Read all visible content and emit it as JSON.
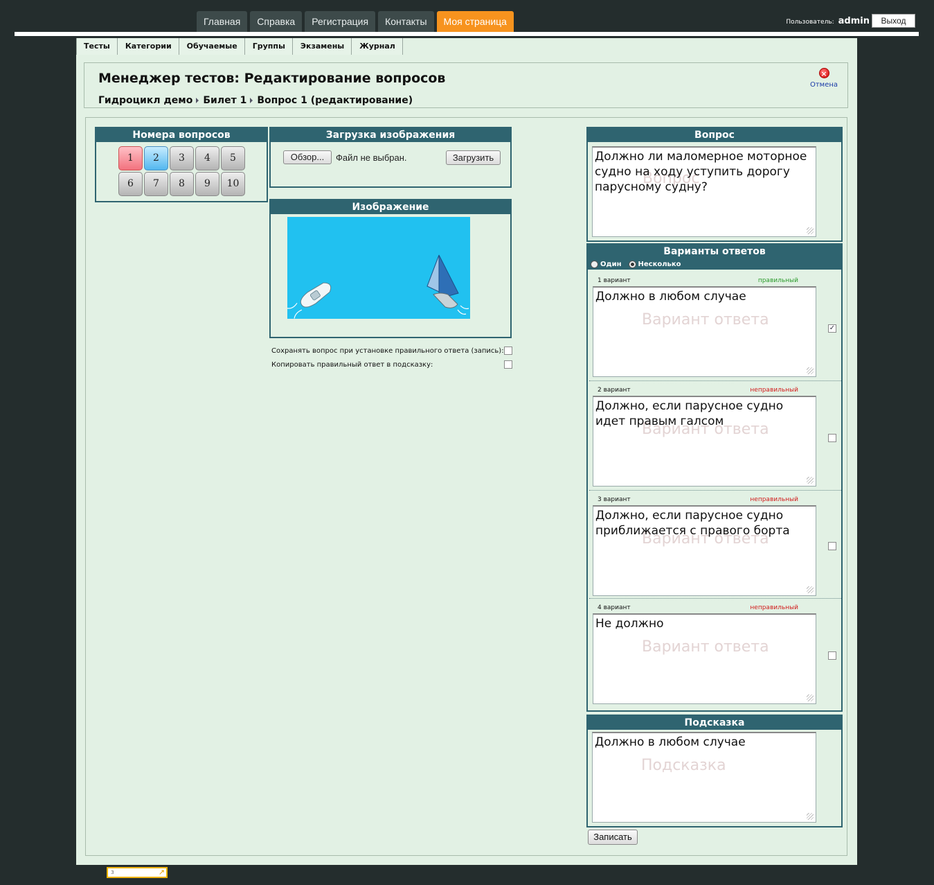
{
  "topnav": {
    "tabs": [
      {
        "label": "Главная",
        "active": false
      },
      {
        "label": "Справка",
        "active": false
      },
      {
        "label": "Регистрация",
        "active": false
      },
      {
        "label": "Контакты",
        "active": false
      },
      {
        "label": "Моя страница",
        "active": true
      }
    ],
    "user_label": "Пользователь:",
    "user_name": "admin",
    "logout_label": "Выход"
  },
  "subnav": {
    "tabs": [
      "Тесты",
      "Категории",
      "Обучаемые",
      "Группы",
      "Экзамены",
      "Журнал"
    ]
  },
  "header": {
    "title": "Менеджер тестов: Редактирование вопросов",
    "breadcrumb": [
      "Гидроцикл демо",
      "Билет 1",
      "Вопрос 1 (редактирование)"
    ],
    "cancel_label": "Отмена",
    "cancel_icon": "close-icon"
  },
  "question_numbers": {
    "title": "Номера вопросов",
    "items": [
      "1",
      "2",
      "3",
      "4",
      "5",
      "6",
      "7",
      "8",
      "9",
      "10"
    ],
    "current": "1",
    "highlighted": "2"
  },
  "upload": {
    "title": "Загрузка изображения",
    "browse_label": "Обзор...",
    "no_file_label": "Файл не выбран.",
    "upload_label": "Загрузить"
  },
  "image": {
    "title": "Изображение",
    "water_color": "#21c1f0"
  },
  "options": {
    "save_on_correct": "Сохранять вопрос при установке правильного ответа (запись):",
    "copy_to_hint": "Копировать правильный ответ в подсказку:"
  },
  "question": {
    "title": "Вопрос",
    "placeholder": "Вопрос",
    "text": "Должно ли маломерное моторное судно на ходу уступить дорогу парусному судну?"
  },
  "answers": {
    "title": "Варианты ответов",
    "mode_one": "Один",
    "mode_many": "Несколько",
    "placeholder": "Вариант ответа",
    "items": [
      {
        "label": "1 вариант",
        "status": "правильный",
        "correct": true,
        "text": "Должно в любом случае"
      },
      {
        "label": "2 вариант",
        "status": "неправильный",
        "correct": false,
        "text": "Должно, если парусное судно идет правым галсом"
      },
      {
        "label": "3 вариант",
        "status": "неправильный",
        "correct": false,
        "text": "Должно, если парусное судно приближается с правого борта"
      },
      {
        "label": "4 вариант",
        "status": "неправильный",
        "correct": false,
        "text": "Не должно"
      }
    ]
  },
  "hint": {
    "title": "Подсказка",
    "placeholder": "Подсказка",
    "text": "Должно в любом случае"
  },
  "save_label": "Записать",
  "colors": {
    "accent": "#f7931e",
    "panel_header": "#2f6470",
    "page_bg": "#e2f1e4",
    "correct": "#2a9a2a",
    "incorrect": "#d21b1b"
  }
}
